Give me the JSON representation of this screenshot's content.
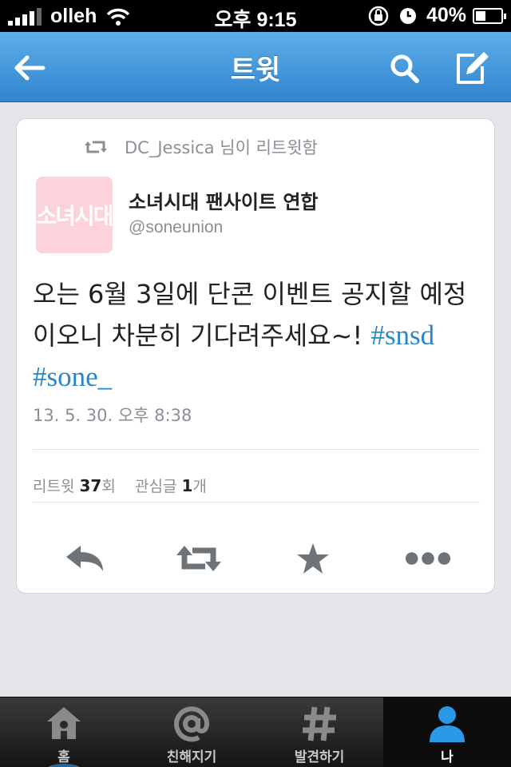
{
  "status_bar": {
    "carrier": "olleh",
    "time": "오후 9:15",
    "battery": "40%",
    "battery_level": 0.4
  },
  "nav": {
    "title": "트윗",
    "back_icon": "back-arrow-icon",
    "search_icon": "search-icon",
    "compose_icon": "compose-icon"
  },
  "tweet": {
    "retweeted_by": "DC_Jessica 님이 리트윗함",
    "avatar_text": "소녀시대",
    "user_name": "소녀시대 팬사이트 연합",
    "user_handle": "@soneunion",
    "text": "오는 6월 3일에 단콘 이벤트 공지할 예정이오니 차분히 기다려주세요~!",
    "hashtags": [
      "#snsd",
      "#sone_"
    ],
    "timestamp": "13. 5. 30. 오후 8:38",
    "stats": {
      "retweet_label": "리트윗",
      "retweet_count": "37",
      "retweet_unit": "회",
      "favorite_label": "관심글",
      "favorite_count": "1",
      "favorite_unit": "개"
    },
    "actions": [
      "reply-icon",
      "retweet-icon",
      "star-icon",
      "more-icon"
    ]
  },
  "tab_bar": {
    "tabs": [
      {
        "label": "홈",
        "icon": "home-icon"
      },
      {
        "label": "친해지기",
        "icon": "at-icon"
      },
      {
        "label": "발견하기",
        "icon": "hash-icon"
      },
      {
        "label": "나",
        "icon": "person-icon"
      }
    ],
    "active_index": 3
  },
  "colors": {
    "nav_blue": "#3a8fd8",
    "link_blue": "#2a86c7",
    "avatar_pink": "#fcd3da",
    "active_tab_blue": "#2a9ae8"
  }
}
